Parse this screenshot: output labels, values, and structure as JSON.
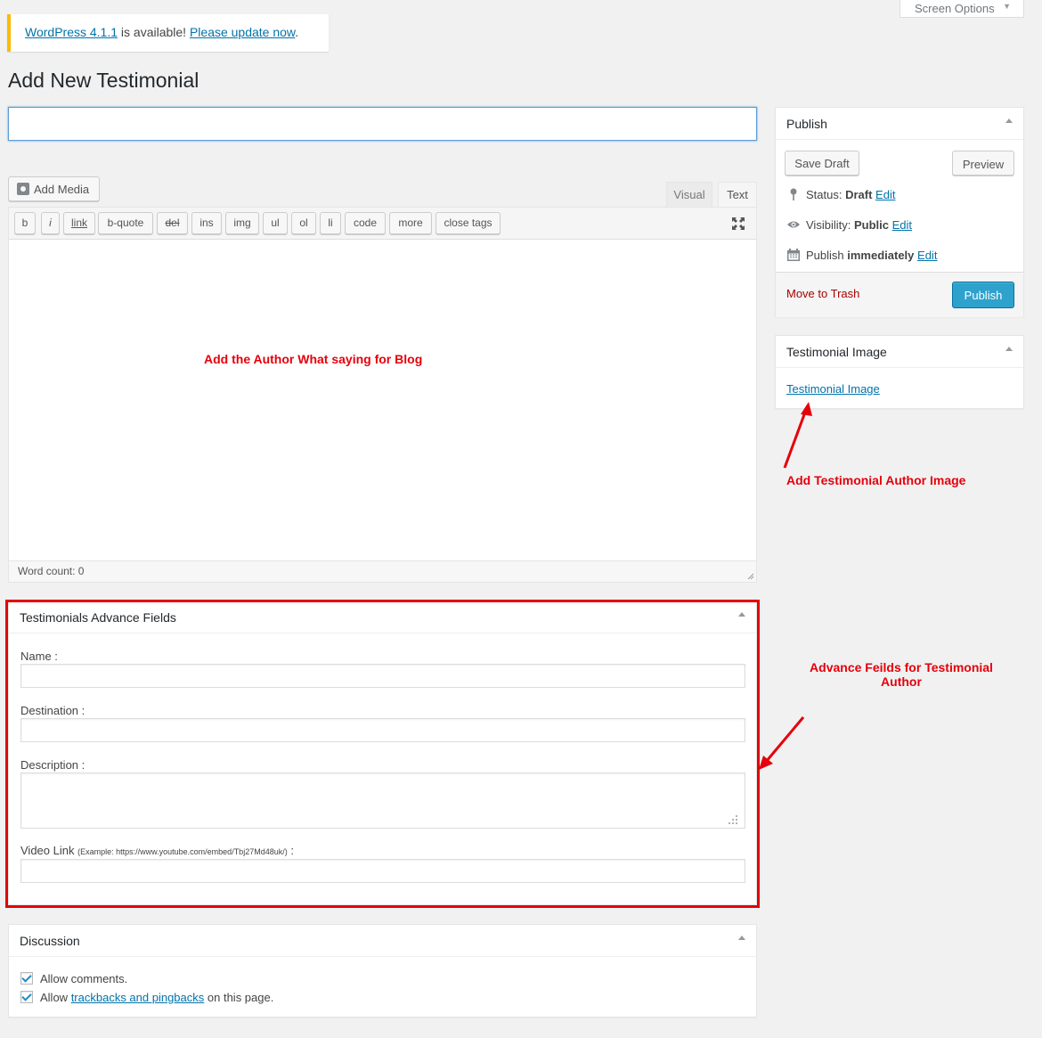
{
  "screen_options": {
    "label": "Screen Options",
    "arrow": "▼"
  },
  "notice": {
    "version_link": "WordPress 4.1.1",
    "middle_text": " is available! ",
    "update_link": "Please update now",
    "end_text": "."
  },
  "page": {
    "title": "Add New Testimonial"
  },
  "title_field": {
    "value": "",
    "placeholder": ""
  },
  "editor": {
    "add_media_label": "Add Media",
    "tab_visual": "Visual",
    "tab_text": "Text",
    "quicktags": [
      "b",
      "i",
      "link",
      "b-quote",
      "del",
      "ins",
      "img",
      "ul",
      "ol",
      "li",
      "code",
      "more",
      "close tags"
    ],
    "word_count": "Word count: 0"
  },
  "annotations": {
    "editor_note": "Add  the Author What saying for Blog",
    "image_note": "Add Testimonial Author Image",
    "advance_note_line1": "Advance Feilds for Testimonial",
    "advance_note_line2": "Author"
  },
  "publish_box": {
    "title": "Publish",
    "save_draft": "Save Draft",
    "preview": "Preview",
    "status_label": "Status: ",
    "status_value": "Draft",
    "visibility_label": "Visibility: ",
    "visibility_value": "Public",
    "publish_label": "Publish ",
    "publish_value": "immediately",
    "edit_link": "Edit",
    "move_to_trash": "Move to Trash",
    "publish_button": "Publish"
  },
  "image_box": {
    "title": "Testimonial Image",
    "link": "Testimonial Image"
  },
  "advance_fields": {
    "title": "Testimonials Advance Fields",
    "name_label": "Name :",
    "destination_label": "Destination :",
    "description_label": "Description :",
    "video_label": "Video Link",
    "video_example": "(Example: https://www.youtube.com/embed/Tbj27Md48uk/)",
    "video_colon": " :",
    "name_value": "",
    "destination_value": "",
    "description_value": "",
    "video_value": ""
  },
  "discussion": {
    "title": "Discussion",
    "allow_comments": "Allow comments.",
    "allow_prefix": "Allow ",
    "trackbacks_link": "trackbacks and pingbacks",
    "allow_suffix": " on this page."
  },
  "colors": {
    "accent": "#0073aa",
    "primary_button": "#2ea2cc",
    "annotation": "#e5000b",
    "notice_border": "#ffba00",
    "trash": "#a00"
  }
}
